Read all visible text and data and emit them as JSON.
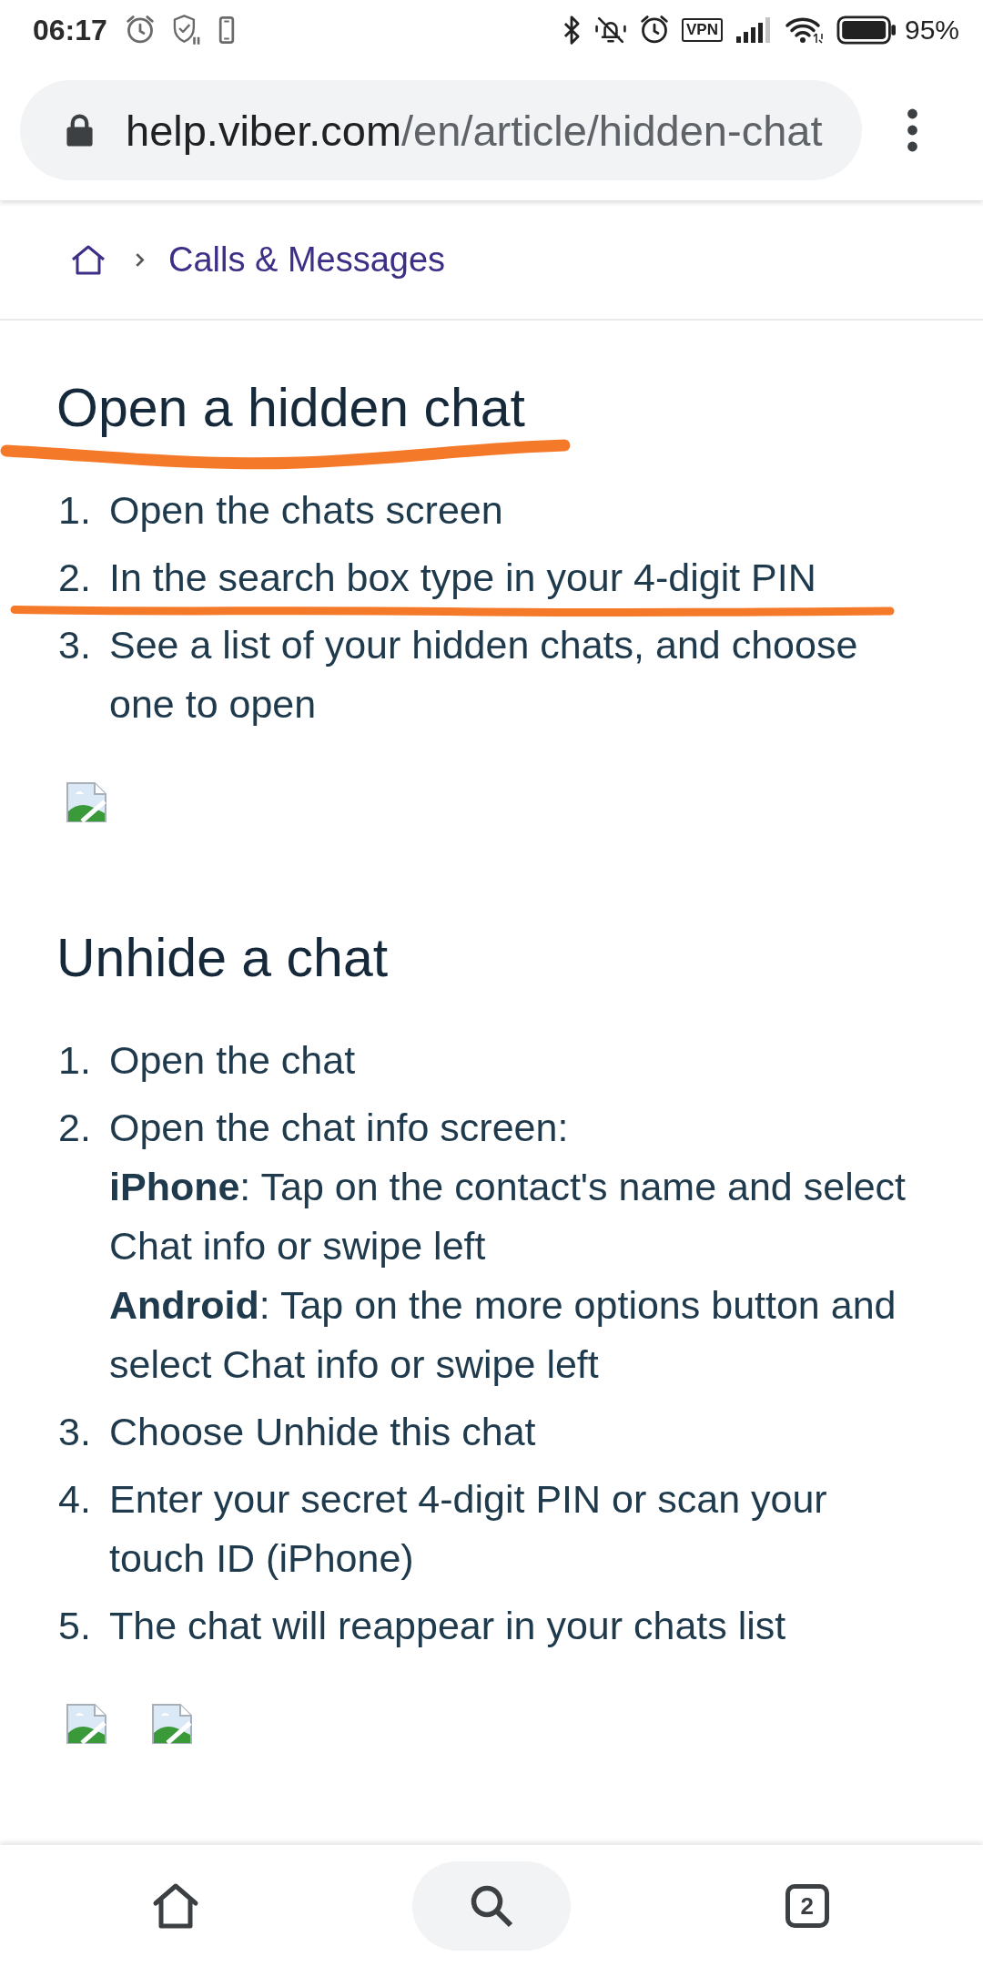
{
  "status_bar": {
    "time": "06:17",
    "vpn": "VPN",
    "battery": "95%"
  },
  "address_bar": {
    "host": "help.viber.com",
    "path": "/en/article/hidden-chat"
  },
  "breadcrumb": [
    {
      "kind": "home"
    },
    {
      "kind": "link",
      "label": "Calls & Messages"
    }
  ],
  "sections": [
    {
      "title": "Open a hidden chat",
      "underlined": true,
      "steps": [
        {
          "number": "1.",
          "text": "Open the chats screen",
          "underlined": false
        },
        {
          "number": "2.",
          "text": "In the search box type in your 4-digit PIN",
          "underlined": true
        },
        {
          "number": "3.",
          "text": "See a list of your hidden chats, and choose one to open",
          "underlined": false
        }
      ],
      "images": [
        {
          "broken": true
        }
      ]
    },
    {
      "title": "Unhide a chat",
      "underlined": false,
      "steps": [
        {
          "number": "1.",
          "text": "Open the chat",
          "underlined": false
        },
        {
          "number": "2.",
          "text": "Open the chat info screen:",
          "notes": [
            "**iPhone**: Tap on the contact's name and select Chat info or swipe left",
            "**Android**: Tap on the more options button and select Chat info or swipe left"
          ],
          "underlined": false
        },
        {
          "number": "3.",
          "text": "Choose Unhide this chat",
          "underlined": false
        },
        {
          "number": "4.",
          "text": "Enter your secret 4-digit PIN or scan your touch ID (iPhone)",
          "underlined": false
        },
        {
          "number": "5.",
          "text": "The chat will reappear in your chats list",
          "underlined": false
        }
      ],
      "images": [
        {
          "broken": true
        },
        {
          "broken": true
        }
      ]
    }
  ],
  "bottom_nav": [
    {
      "kind": "home",
      "selected": false
    },
    {
      "kind": "search",
      "selected": true
    },
    {
      "kind": "tabs",
      "count": "2",
      "selected": false
    }
  ]
}
